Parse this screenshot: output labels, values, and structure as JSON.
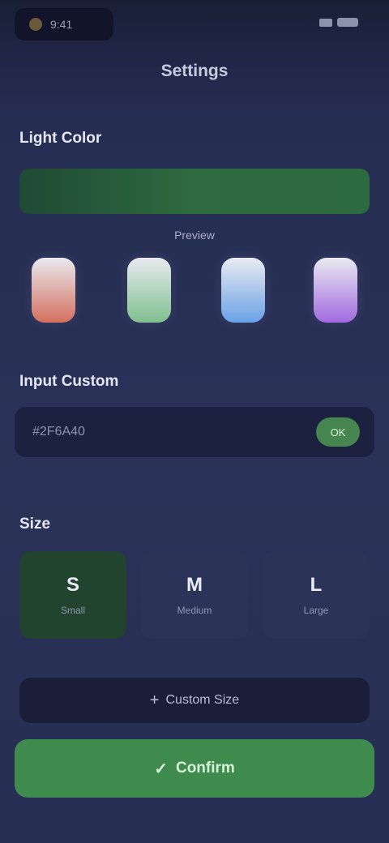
{
  "status_bar": {
    "time": "9:41"
  },
  "header": {
    "title": "Settings"
  },
  "sections": {
    "color": "Light Color",
    "input": "Input Custom",
    "size": "Size"
  },
  "preview": {
    "caption": "Preview",
    "color": "#2f6a40"
  },
  "color_options": [
    {
      "name": "Red",
      "color": "#d4705e"
    },
    {
      "name": "Green",
      "color": "#7fbf8e"
    },
    {
      "name": "Blue",
      "color": "#6aa2e6"
    },
    {
      "name": "Purple",
      "color": "#a26ae0"
    }
  ],
  "input": {
    "placeholder": "#2F6A40",
    "apply_label": "OK",
    "hint": ""
  },
  "sizes": [
    {
      "value": "S",
      "label": "Small",
      "selected": true
    },
    {
      "value": "M",
      "label": "Medium",
      "selected": false
    },
    {
      "value": "L",
      "label": "Large",
      "selected": false
    }
  ],
  "buttons": {
    "custom": "Custom Size",
    "primary": "Confirm"
  },
  "colors": {
    "accent": "#3f8a4d",
    "background": "#262d52"
  }
}
